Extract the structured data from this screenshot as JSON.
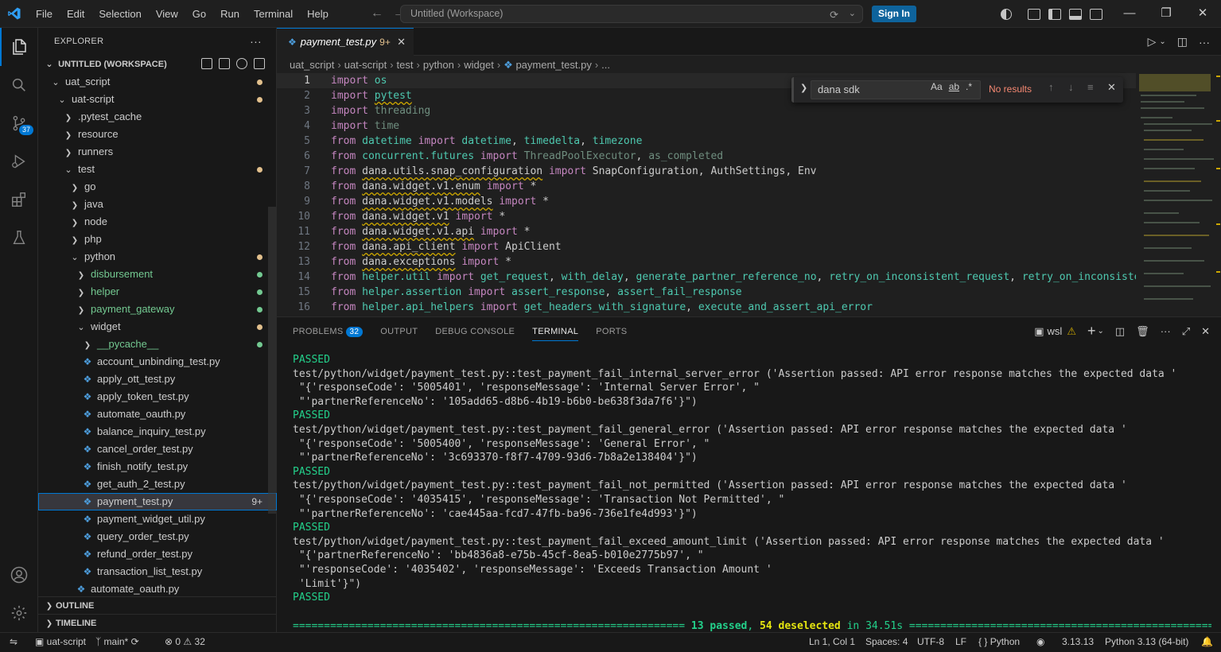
{
  "menu": [
    "File",
    "Edit",
    "Selection",
    "View",
    "Go",
    "Run",
    "Terminal",
    "Help"
  ],
  "search": {
    "text": "Untitled (Workspace)"
  },
  "signin_label": "Sign In",
  "sidebar": {
    "title": "EXPLORER",
    "workspace": "UNTITLED (WORKSPACE)",
    "tree": [
      {
        "label": "uat_script",
        "depth": 1,
        "kind": "folder-open",
        "dot": "#e2c08d"
      },
      {
        "label": "uat-script",
        "depth": 2,
        "kind": "folder-open",
        "dot": "#e2c08d"
      },
      {
        "label": ".pytest_cache",
        "depth": 3,
        "kind": "folder"
      },
      {
        "label": "resource",
        "depth": 3,
        "kind": "folder"
      },
      {
        "label": "runners",
        "depth": 3,
        "kind": "folder"
      },
      {
        "label": "test",
        "depth": 3,
        "kind": "folder-open",
        "dot": "#e2c08d"
      },
      {
        "label": "go",
        "depth": 4,
        "kind": "folder"
      },
      {
        "label": "java",
        "depth": 4,
        "kind": "folder"
      },
      {
        "label": "node",
        "depth": 4,
        "kind": "folder"
      },
      {
        "label": "php",
        "depth": 4,
        "kind": "folder"
      },
      {
        "label": "python",
        "depth": 4,
        "kind": "folder-open",
        "dot": "#e2c08d"
      },
      {
        "label": "disbursement",
        "depth": 5,
        "kind": "folder",
        "green": true,
        "dot": "#73c991"
      },
      {
        "label": "helper",
        "depth": 5,
        "kind": "folder",
        "green": true,
        "dot": "#73c991"
      },
      {
        "label": "payment_gateway",
        "depth": 5,
        "kind": "folder",
        "green": true,
        "dot": "#73c991"
      },
      {
        "label": "widget",
        "depth": 5,
        "kind": "folder-open",
        "dot": "#e2c08d"
      },
      {
        "label": "__pycache__",
        "depth": 6,
        "kind": "folder",
        "green": true,
        "dot": "#73c991"
      },
      {
        "label": "account_unbinding_test.py",
        "depth": 6,
        "kind": "py"
      },
      {
        "label": "apply_ott_test.py",
        "depth": 6,
        "kind": "py"
      },
      {
        "label": "apply_token_test.py",
        "depth": 6,
        "kind": "py"
      },
      {
        "label": "automate_oauth.py",
        "depth": 6,
        "kind": "py"
      },
      {
        "label": "balance_inquiry_test.py",
        "depth": 6,
        "kind": "py"
      },
      {
        "label": "cancel_order_test.py",
        "depth": 6,
        "kind": "py"
      },
      {
        "label": "finish_notify_test.py",
        "depth": 6,
        "kind": "py"
      },
      {
        "label": "get_auth_2_test.py",
        "depth": 6,
        "kind": "py"
      },
      {
        "label": "payment_test.py",
        "depth": 6,
        "kind": "py",
        "selected": true,
        "count": "9+"
      },
      {
        "label": "payment_widget_util.py",
        "depth": 6,
        "kind": "py"
      },
      {
        "label": "query_order_test.py",
        "depth": 6,
        "kind": "py"
      },
      {
        "label": "refund_order_test.py",
        "depth": 6,
        "kind": "py"
      },
      {
        "label": "transaction_list_test.py",
        "depth": 6,
        "kind": "py"
      },
      {
        "label": "automate_oauth.py",
        "depth": 5,
        "kind": "py"
      }
    ],
    "outline": "OUTLINE",
    "timeline": "TIMELINE"
  },
  "tab": {
    "label": "payment_test.py",
    "modified": "9+"
  },
  "breadcrumb": [
    "uat_script",
    "uat-script",
    "test",
    "python",
    "widget",
    "payment_test.py",
    "..."
  ],
  "find": {
    "value": "dana sdk",
    "result": "No results",
    "opt_case": "Aa",
    "opt_word": "ab",
    "opt_regex": ".*"
  },
  "code": [
    [
      [
        "kw",
        "import"
      ],
      [
        "t",
        " "
      ],
      [
        "mod1",
        "os"
      ]
    ],
    [
      [
        "kw",
        "import"
      ],
      [
        "t",
        " "
      ],
      [
        "mod1sq",
        "pytest"
      ]
    ],
    [
      [
        "kw",
        "import"
      ],
      [
        "t",
        " "
      ],
      [
        "dim",
        "threading"
      ]
    ],
    [
      [
        "kw",
        "import"
      ],
      [
        "t",
        " "
      ],
      [
        "dim",
        "time"
      ]
    ],
    [
      [
        "kw",
        "from"
      ],
      [
        "t",
        " "
      ],
      [
        "mod1",
        "datetime"
      ],
      [
        "t",
        " "
      ],
      [
        "kw",
        "import"
      ],
      [
        "t",
        " "
      ],
      [
        "mod1",
        "datetime"
      ],
      [
        "t",
        ", "
      ],
      [
        "mod1",
        "timedelta"
      ],
      [
        "t",
        ", "
      ],
      [
        "mod1",
        "timezone"
      ]
    ],
    [
      [
        "kw",
        "from"
      ],
      [
        "t",
        " "
      ],
      [
        "mod1",
        "concurrent.futures"
      ],
      [
        "t",
        " "
      ],
      [
        "kw",
        "import"
      ],
      [
        "t",
        " "
      ],
      [
        "dim",
        "ThreadPoolExecutor"
      ],
      [
        "t",
        ", "
      ],
      [
        "dim",
        "as_completed"
      ]
    ],
    [
      [
        "kw",
        "from"
      ],
      [
        "t",
        " "
      ],
      [
        "sq",
        "dana.utils.snap_configuration"
      ],
      [
        "t",
        " "
      ],
      [
        "kw",
        "import"
      ],
      [
        "t",
        " SnapConfiguration, AuthSettings, Env"
      ]
    ],
    [
      [
        "kw",
        "from"
      ],
      [
        "t",
        " "
      ],
      [
        "sq",
        "dana.widget.v1.enum"
      ],
      [
        "t",
        " "
      ],
      [
        "kw",
        "import"
      ],
      [
        "t",
        " *"
      ]
    ],
    [
      [
        "kw",
        "from"
      ],
      [
        "t",
        " "
      ],
      [
        "sq",
        "dana.widget.v1.models"
      ],
      [
        "t",
        " "
      ],
      [
        "kw",
        "import"
      ],
      [
        "t",
        " *"
      ]
    ],
    [
      [
        "kw",
        "from"
      ],
      [
        "t",
        " "
      ],
      [
        "sq",
        "dana.widget.v1"
      ],
      [
        "t",
        " "
      ],
      [
        "kw",
        "import"
      ],
      [
        "t",
        " *"
      ]
    ],
    [
      [
        "kw",
        "from"
      ],
      [
        "t",
        " "
      ],
      [
        "sq",
        "dana.widget.v1.api"
      ],
      [
        "t",
        " "
      ],
      [
        "kw",
        "import"
      ],
      [
        "t",
        " *"
      ]
    ],
    [
      [
        "kw",
        "from"
      ],
      [
        "t",
        " "
      ],
      [
        "sq",
        "dana.api_client"
      ],
      [
        "t",
        " "
      ],
      [
        "kw",
        "import"
      ],
      [
        "t",
        " ApiClient"
      ]
    ],
    [
      [
        "kw",
        "from"
      ],
      [
        "t",
        " "
      ],
      [
        "sq",
        "dana.exceptions"
      ],
      [
        "t",
        " "
      ],
      [
        "kw",
        "import"
      ],
      [
        "t",
        " *"
      ]
    ],
    [
      [
        "kw",
        "from"
      ],
      [
        "t",
        " "
      ],
      [
        "mod1",
        "helper.util"
      ],
      [
        "t",
        " "
      ],
      [
        "kw",
        "import"
      ],
      [
        "t",
        " "
      ],
      [
        "mod1",
        "get_request"
      ],
      [
        "t",
        ", "
      ],
      [
        "mod1",
        "with_delay"
      ],
      [
        "t",
        ", "
      ],
      [
        "mod1",
        "generate_partner_reference_no"
      ],
      [
        "t",
        ", "
      ],
      [
        "mod1",
        "retry_on_inconsistent_request"
      ],
      [
        "t",
        ", "
      ],
      [
        "mod1",
        "retry_on_inconsisten"
      ]
    ],
    [
      [
        "kw",
        "from"
      ],
      [
        "t",
        " "
      ],
      [
        "mod1",
        "helper.assertion"
      ],
      [
        "t",
        " "
      ],
      [
        "kw",
        "import"
      ],
      [
        "t",
        " "
      ],
      [
        "mod1",
        "assert_response"
      ],
      [
        "t",
        ", "
      ],
      [
        "mod1",
        "assert_fail_response"
      ]
    ],
    [
      [
        "kw",
        "from"
      ],
      [
        "t",
        " "
      ],
      [
        "mod1",
        "helper.api_helpers"
      ],
      [
        "t",
        " "
      ],
      [
        "kw",
        "import"
      ],
      [
        "t",
        " "
      ],
      [
        "mod1",
        "get_headers_with_signature"
      ],
      [
        "t",
        ", "
      ],
      [
        "mod1",
        "execute_and_assert_api_error"
      ]
    ]
  ],
  "panel": {
    "tabs": [
      "PROBLEMS",
      "OUTPUT",
      "DEBUG CONSOLE",
      "TERMINAL",
      "PORTS"
    ],
    "problems_count": "32",
    "shell": "wsl",
    "terminal": [
      {
        "text": "PASSED",
        "pass": true
      },
      {
        "text": "test/python/widget/payment_test.py::test_payment_fail_internal_server_error ('Assertion passed: API error response matches the expected data '"
      },
      {
        "text": " \"{'responseCode': '5005401', 'responseMessage': 'Internal Server Error', \""
      },
      {
        "text": " \"'partnerReferenceNo': '105add65-d8b6-4b19-b6b0-be638f3da7f6'}\")"
      },
      {
        "text": "PASSED",
        "pass": true
      },
      {
        "text": "test/python/widget/payment_test.py::test_payment_fail_general_error ('Assertion passed: API error response matches the expected data '"
      },
      {
        "text": " \"{'responseCode': '5005400', 'responseMessage': 'General Error', \""
      },
      {
        "text": " \"'partnerReferenceNo': '3c693370-f8f7-4709-93d6-7b8a2e138404'}\")"
      },
      {
        "text": "PASSED",
        "pass": true
      },
      {
        "text": "test/python/widget/payment_test.py::test_payment_fail_not_permitted ('Assertion passed: API error response matches the expected data '"
      },
      {
        "text": " \"{'responseCode': '4035415', 'responseMessage': 'Transaction Not Permitted', \""
      },
      {
        "text": " \"'partnerReferenceNo': 'cae445aa-fcd7-47fb-ba96-736e1fe4d993'}\")"
      },
      {
        "text": "PASSED",
        "pass": true
      },
      {
        "text": "test/python/widget/payment_test.py::test_payment_fail_exceed_amount_limit ('Assertion passed: API error response matches the expected data '"
      },
      {
        "text": " \"{'partnerReferenceNo': 'bb4836a8-e75b-45cf-8ea5-b010e2775b97', \""
      },
      {
        "text": " \"'responseCode': '4035402', 'responseMessage': 'Exceeds Transaction Amount '"
      },
      {
        "text": " 'Limit'}\")"
      },
      {
        "text": "PASSED",
        "pass": true
      }
    ],
    "summary_left": "=============================================================== ",
    "summary_passed": "13 passed",
    "summary_sep": ", ",
    "summary_desel": "54 deselected",
    "summary_time": " in 34.51s",
    "summary_right": " ============================================================"
  },
  "status": {
    "remote": "uat-script",
    "branch": "main*",
    "errors": "0",
    "warnings": "32",
    "position": "Ln 1, Col 1",
    "spaces": "Spaces: 4",
    "encoding": "UTF-8",
    "eol": "LF",
    "language": "Python",
    "version": "3.13.13",
    "interpreter": "Python 3.13 (64-bit)"
  }
}
